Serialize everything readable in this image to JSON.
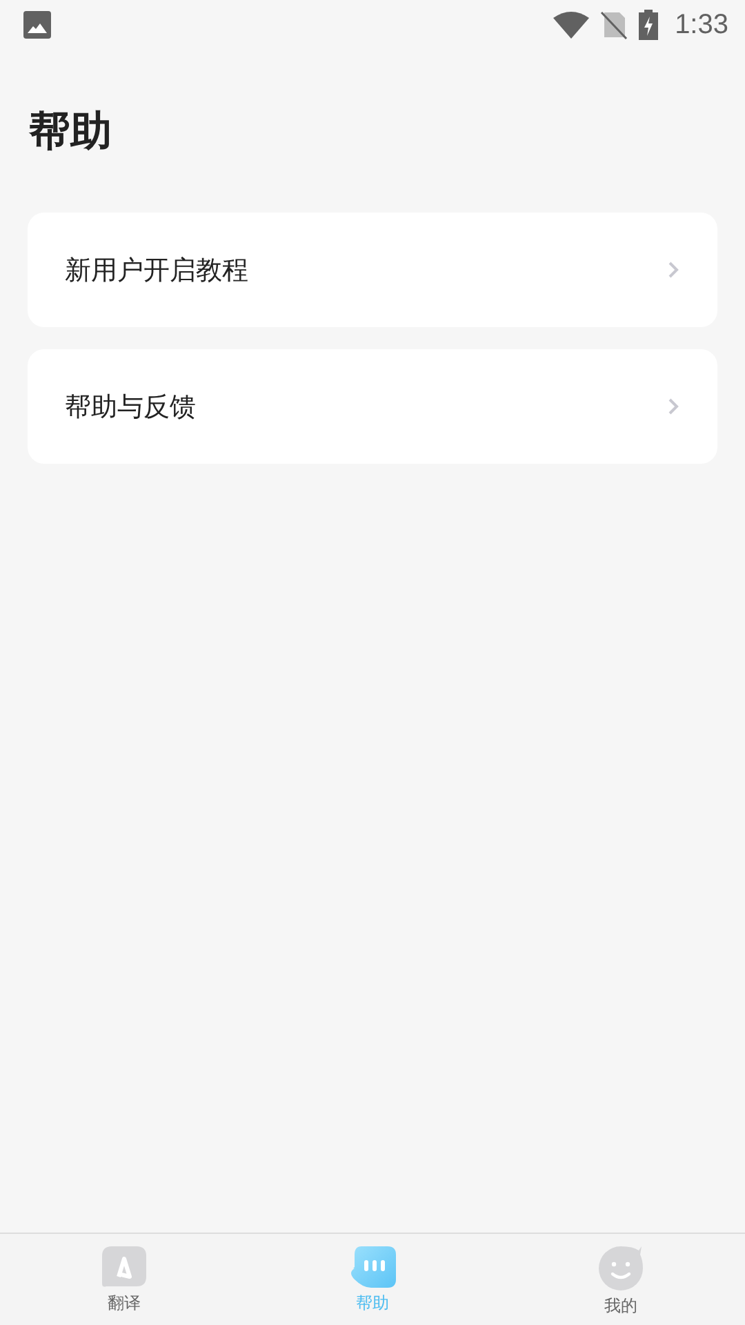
{
  "status_bar": {
    "time": "1:33"
  },
  "title": "帮助",
  "menu_items": [
    {
      "label": "新用户开启教程"
    },
    {
      "label": "帮助与反馈"
    }
  ],
  "tabs": [
    {
      "label": "翻译",
      "kind": "translate",
      "selected": false
    },
    {
      "label": "帮助",
      "kind": "help",
      "selected": true
    },
    {
      "label": "我的",
      "kind": "profile",
      "selected": false
    }
  ]
}
